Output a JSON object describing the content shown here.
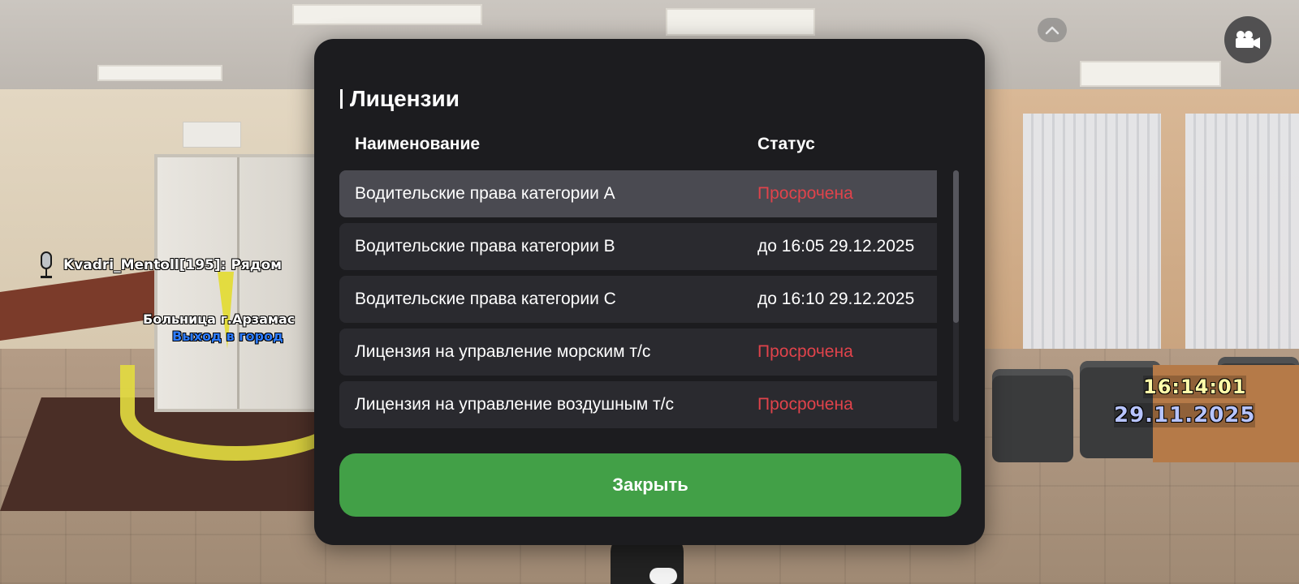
{
  "hud": {
    "speaker": "Kvadri_Mentoll[195]: Рядом",
    "location_name": "Больница г.Арзамас",
    "location_action": "Выход в город",
    "time": "16:14:01",
    "date": "29.11.2025"
  },
  "modal": {
    "title": "Лицензии",
    "columns": {
      "name": "Наименование",
      "status": "Статус"
    },
    "rows": [
      {
        "name": "Водительские права категории A",
        "status": "Просрочена"
      },
      {
        "name": "Водительские права категории B",
        "status": "до 16:05 29.12.2025"
      },
      {
        "name": "Водительские права категории C",
        "status": "до 16:10 29.12.2025"
      },
      {
        "name": "Лицензия на управление морским т/с",
        "status": "Просрочена"
      },
      {
        "name": "Лицензия на управление воздушным т/с",
        "status": "Просрочена"
      }
    ],
    "close_label": "Закрыть"
  },
  "colors": {
    "expired": "#e0434b",
    "accent_button": "#42a047",
    "modal_bg": "#1c1c1f",
    "row_bg": "#2a2a2f",
    "row_selected_bg": "#4a4a51"
  },
  "icons": {
    "top_toggle": "chevron-up-icon",
    "camera": "video-camera-icon",
    "voice": "microphone-icon"
  }
}
